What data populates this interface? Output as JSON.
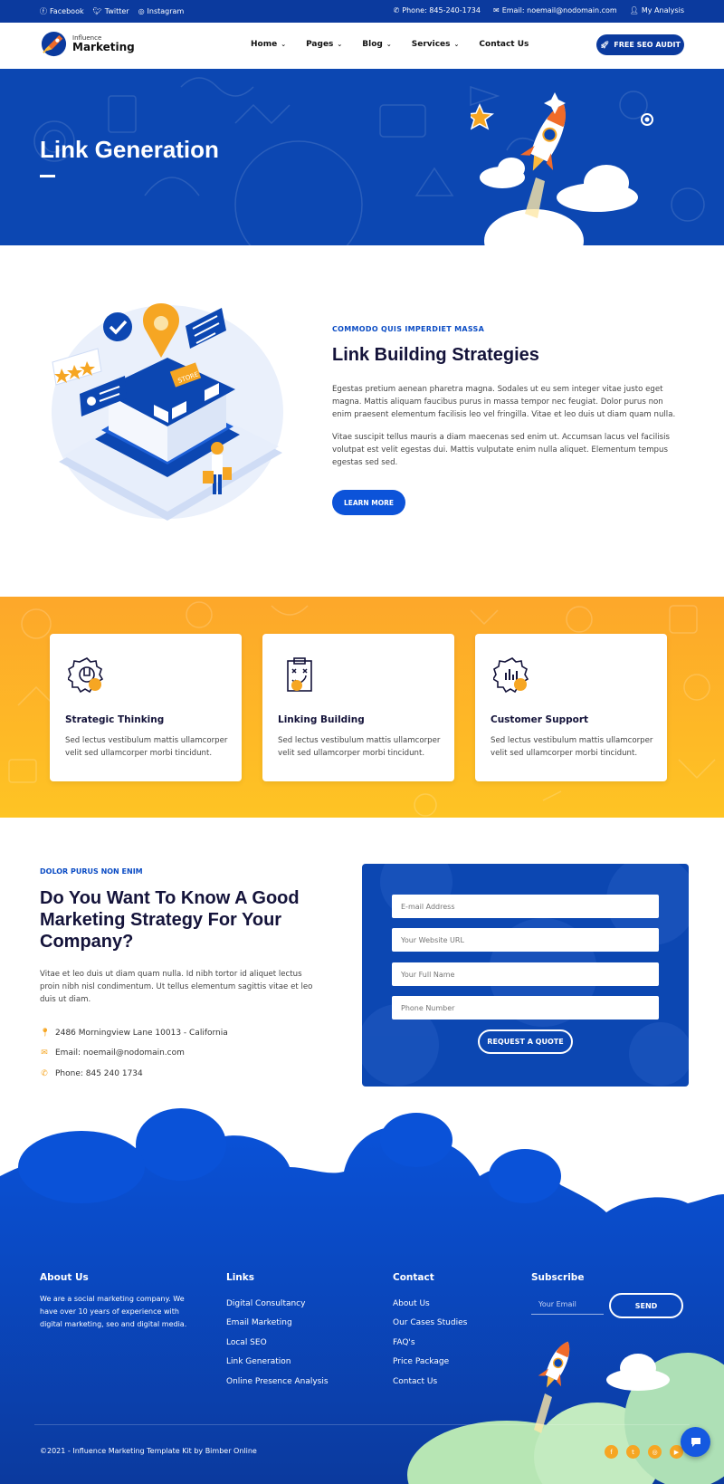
{
  "topbar": {
    "social": [
      "Facebook",
      "Twitter",
      "Instagram"
    ],
    "phone": "Phone: 845-240-1734",
    "email": "Email: noemail@nodomain.com",
    "account": "My Analysis"
  },
  "header": {
    "logo_sub": "Influence",
    "logo_main": "Marketing",
    "nav": [
      {
        "label": "Home"
      },
      {
        "label": "Pages"
      },
      {
        "label": "Blog"
      },
      {
        "label": "Services"
      },
      {
        "label": "Contact Us"
      }
    ],
    "cta": "FREE SEO AUDIT"
  },
  "hero": {
    "title": "Link Generation"
  },
  "about": {
    "tag": "COMMODO QUIS IMPERDIET MASSA",
    "title": "Link Building Strategies",
    "p1": "Egestas pretium aenean pharetra magna. Sodales ut eu sem integer vitae justo eget magna. Mattis aliquam faucibus purus in massa tempor nec feugiat. Dolor purus non enim praesent elementum facilisis leo vel fringilla. Vitae et leo duis ut diam quam nulla.",
    "p2": "Vitae suscipit tellus mauris a diam maecenas sed enim ut. Accumsan lacus vel facilisis volutpat est velit egestas dui. Mattis vulputate enim nulla aliquet. Elementum tempus egestas sed sed.",
    "button": "LEARN MORE",
    "illustration_sign": "STORE"
  },
  "features": [
    {
      "title": "Strategic Thinking",
      "text": "Sed lectus vestibulum mattis ullamcorper velit sed ullamcorper morbi tincidunt."
    },
    {
      "title": "Linking Building",
      "text": "Sed lectus vestibulum mattis ullamcorper velit sed ullamcorper morbi tincidunt."
    },
    {
      "title": "Customer Support",
      "text": "Sed lectus vestibulum mattis ullamcorper velit sed ullamcorper morbi tincidunt."
    }
  ],
  "contact": {
    "tag": "DOLOR PURUS NON ENIM",
    "title": "Do You Want To Know A Good Marketing Strategy For Your Company?",
    "text": "Vitae et leo duis ut diam quam nulla. Id nibh tortor id aliquet lectus proin nibh nisl condimentum. Ut tellus elementum sagittis vitae et leo duis ut diam.",
    "address": "2486 Morningview Lane 10013 - California",
    "email": "Email: noemail@nodomain.com",
    "phone": "Phone: 845 240 1734",
    "form": {
      "email_placeholder": "E-mail Address",
      "website_placeholder": "Your Website URL",
      "name_placeholder": "Your Full Name",
      "phone_placeholder": "Phone Number",
      "submit": "REQUEST A QUOTE"
    }
  },
  "footer": {
    "about_title": "About Us",
    "about_text": "We are a social marketing company. We have over 10 years of experience with digital marketing, seo and digital media.",
    "links_title": "Links",
    "links": [
      "Digital Consultancy",
      "Email Marketing",
      "Local SEO",
      "Link Generation",
      "Online Presence Analysis"
    ],
    "contact_title": "Contact",
    "contact_links": [
      "About Us",
      "Our Cases Studies",
      "FAQ's",
      "Price Package",
      "Contact Us"
    ],
    "subscribe_title": "Subscribe",
    "subscribe_placeholder": "Your Email",
    "send": "SEND",
    "copyright": "©2021 - Influence Marketing Template Kit by Bimber Online"
  },
  "colors": {
    "primary_blue": "#0b3a9e",
    "accent_orange": "#f6a623",
    "button_blue": "#0c53d9"
  }
}
